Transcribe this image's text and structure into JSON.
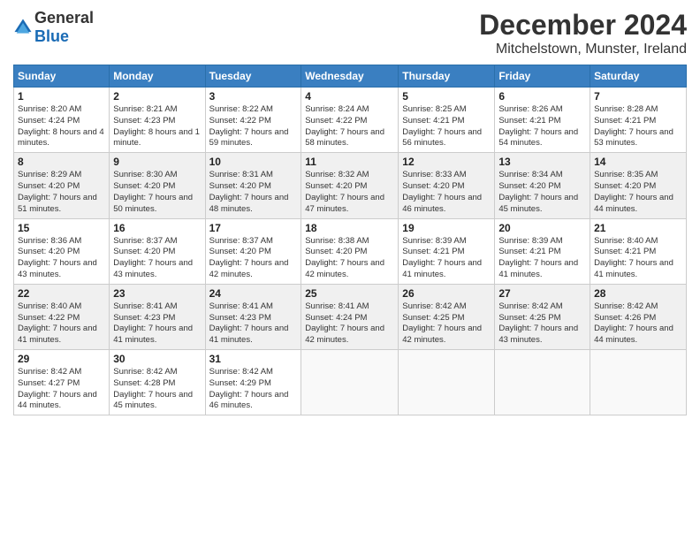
{
  "header": {
    "logo_general": "General",
    "logo_blue": "Blue",
    "title": "December 2024",
    "subtitle": "Mitchelstown, Munster, Ireland"
  },
  "days_of_week": [
    "Sunday",
    "Monday",
    "Tuesday",
    "Wednesday",
    "Thursday",
    "Friday",
    "Saturday"
  ],
  "weeks": [
    [
      {
        "day": "1",
        "sunrise": "Sunrise: 8:20 AM",
        "sunset": "Sunset: 4:24 PM",
        "daylight": "Daylight: 8 hours and 4 minutes."
      },
      {
        "day": "2",
        "sunrise": "Sunrise: 8:21 AM",
        "sunset": "Sunset: 4:23 PM",
        "daylight": "Daylight: 8 hours and 1 minute."
      },
      {
        "day": "3",
        "sunrise": "Sunrise: 8:22 AM",
        "sunset": "Sunset: 4:22 PM",
        "daylight": "Daylight: 7 hours and 59 minutes."
      },
      {
        "day": "4",
        "sunrise": "Sunrise: 8:24 AM",
        "sunset": "Sunset: 4:22 PM",
        "daylight": "Daylight: 7 hours and 58 minutes."
      },
      {
        "day": "5",
        "sunrise": "Sunrise: 8:25 AM",
        "sunset": "Sunset: 4:21 PM",
        "daylight": "Daylight: 7 hours and 56 minutes."
      },
      {
        "day": "6",
        "sunrise": "Sunrise: 8:26 AM",
        "sunset": "Sunset: 4:21 PM",
        "daylight": "Daylight: 7 hours and 54 minutes."
      },
      {
        "day": "7",
        "sunrise": "Sunrise: 8:28 AM",
        "sunset": "Sunset: 4:21 PM",
        "daylight": "Daylight: 7 hours and 53 minutes."
      }
    ],
    [
      {
        "day": "8",
        "sunrise": "Sunrise: 8:29 AM",
        "sunset": "Sunset: 4:20 PM",
        "daylight": "Daylight: 7 hours and 51 minutes."
      },
      {
        "day": "9",
        "sunrise": "Sunrise: 8:30 AM",
        "sunset": "Sunset: 4:20 PM",
        "daylight": "Daylight: 7 hours and 50 minutes."
      },
      {
        "day": "10",
        "sunrise": "Sunrise: 8:31 AM",
        "sunset": "Sunset: 4:20 PM",
        "daylight": "Daylight: 7 hours and 48 minutes."
      },
      {
        "day": "11",
        "sunrise": "Sunrise: 8:32 AM",
        "sunset": "Sunset: 4:20 PM",
        "daylight": "Daylight: 7 hours and 47 minutes."
      },
      {
        "day": "12",
        "sunrise": "Sunrise: 8:33 AM",
        "sunset": "Sunset: 4:20 PM",
        "daylight": "Daylight: 7 hours and 46 minutes."
      },
      {
        "day": "13",
        "sunrise": "Sunrise: 8:34 AM",
        "sunset": "Sunset: 4:20 PM",
        "daylight": "Daylight: 7 hours and 45 minutes."
      },
      {
        "day": "14",
        "sunrise": "Sunrise: 8:35 AM",
        "sunset": "Sunset: 4:20 PM",
        "daylight": "Daylight: 7 hours and 44 minutes."
      }
    ],
    [
      {
        "day": "15",
        "sunrise": "Sunrise: 8:36 AM",
        "sunset": "Sunset: 4:20 PM",
        "daylight": "Daylight: 7 hours and 43 minutes."
      },
      {
        "day": "16",
        "sunrise": "Sunrise: 8:37 AM",
        "sunset": "Sunset: 4:20 PM",
        "daylight": "Daylight: 7 hours and 43 minutes."
      },
      {
        "day": "17",
        "sunrise": "Sunrise: 8:37 AM",
        "sunset": "Sunset: 4:20 PM",
        "daylight": "Daylight: 7 hours and 42 minutes."
      },
      {
        "day": "18",
        "sunrise": "Sunrise: 8:38 AM",
        "sunset": "Sunset: 4:20 PM",
        "daylight": "Daylight: 7 hours and 42 minutes."
      },
      {
        "day": "19",
        "sunrise": "Sunrise: 8:39 AM",
        "sunset": "Sunset: 4:21 PM",
        "daylight": "Daylight: 7 hours and 41 minutes."
      },
      {
        "day": "20",
        "sunrise": "Sunrise: 8:39 AM",
        "sunset": "Sunset: 4:21 PM",
        "daylight": "Daylight: 7 hours and 41 minutes."
      },
      {
        "day": "21",
        "sunrise": "Sunrise: 8:40 AM",
        "sunset": "Sunset: 4:21 PM",
        "daylight": "Daylight: 7 hours and 41 minutes."
      }
    ],
    [
      {
        "day": "22",
        "sunrise": "Sunrise: 8:40 AM",
        "sunset": "Sunset: 4:22 PM",
        "daylight": "Daylight: 7 hours and 41 minutes."
      },
      {
        "day": "23",
        "sunrise": "Sunrise: 8:41 AM",
        "sunset": "Sunset: 4:23 PM",
        "daylight": "Daylight: 7 hours and 41 minutes."
      },
      {
        "day": "24",
        "sunrise": "Sunrise: 8:41 AM",
        "sunset": "Sunset: 4:23 PM",
        "daylight": "Daylight: 7 hours and 41 minutes."
      },
      {
        "day": "25",
        "sunrise": "Sunrise: 8:41 AM",
        "sunset": "Sunset: 4:24 PM",
        "daylight": "Daylight: 7 hours and 42 minutes."
      },
      {
        "day": "26",
        "sunrise": "Sunrise: 8:42 AM",
        "sunset": "Sunset: 4:25 PM",
        "daylight": "Daylight: 7 hours and 42 minutes."
      },
      {
        "day": "27",
        "sunrise": "Sunrise: 8:42 AM",
        "sunset": "Sunset: 4:25 PM",
        "daylight": "Daylight: 7 hours and 43 minutes."
      },
      {
        "day": "28",
        "sunrise": "Sunrise: 8:42 AM",
        "sunset": "Sunset: 4:26 PM",
        "daylight": "Daylight: 7 hours and 44 minutes."
      }
    ],
    [
      {
        "day": "29",
        "sunrise": "Sunrise: 8:42 AM",
        "sunset": "Sunset: 4:27 PM",
        "daylight": "Daylight: 7 hours and 44 minutes."
      },
      {
        "day": "30",
        "sunrise": "Sunrise: 8:42 AM",
        "sunset": "Sunset: 4:28 PM",
        "daylight": "Daylight: 7 hours and 45 minutes."
      },
      {
        "day": "31",
        "sunrise": "Sunrise: 8:42 AM",
        "sunset": "Sunset: 4:29 PM",
        "daylight": "Daylight: 7 hours and 46 minutes."
      },
      null,
      null,
      null,
      null
    ]
  ]
}
